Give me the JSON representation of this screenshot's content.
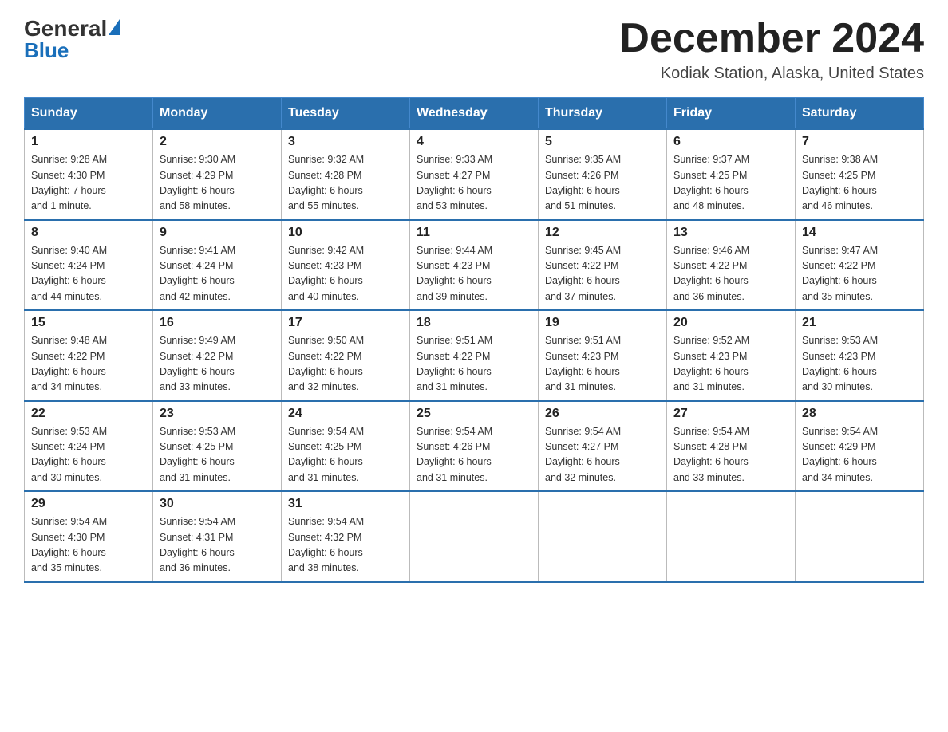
{
  "header": {
    "logo_general": "General",
    "logo_blue": "Blue",
    "month_title": "December 2024",
    "location": "Kodiak Station, Alaska, United States"
  },
  "days_of_week": [
    "Sunday",
    "Monday",
    "Tuesday",
    "Wednesday",
    "Thursday",
    "Friday",
    "Saturday"
  ],
  "weeks": [
    [
      {
        "day": "1",
        "sunrise": "Sunrise: 9:28 AM",
        "sunset": "Sunset: 4:30 PM",
        "daylight": "Daylight: 7 hours",
        "daylight2": "and 1 minute."
      },
      {
        "day": "2",
        "sunrise": "Sunrise: 9:30 AM",
        "sunset": "Sunset: 4:29 PM",
        "daylight": "Daylight: 6 hours",
        "daylight2": "and 58 minutes."
      },
      {
        "day": "3",
        "sunrise": "Sunrise: 9:32 AM",
        "sunset": "Sunset: 4:28 PM",
        "daylight": "Daylight: 6 hours",
        "daylight2": "and 55 minutes."
      },
      {
        "day": "4",
        "sunrise": "Sunrise: 9:33 AM",
        "sunset": "Sunset: 4:27 PM",
        "daylight": "Daylight: 6 hours",
        "daylight2": "and 53 minutes."
      },
      {
        "day": "5",
        "sunrise": "Sunrise: 9:35 AM",
        "sunset": "Sunset: 4:26 PM",
        "daylight": "Daylight: 6 hours",
        "daylight2": "and 51 minutes."
      },
      {
        "day": "6",
        "sunrise": "Sunrise: 9:37 AM",
        "sunset": "Sunset: 4:25 PM",
        "daylight": "Daylight: 6 hours",
        "daylight2": "and 48 minutes."
      },
      {
        "day": "7",
        "sunrise": "Sunrise: 9:38 AM",
        "sunset": "Sunset: 4:25 PM",
        "daylight": "Daylight: 6 hours",
        "daylight2": "and 46 minutes."
      }
    ],
    [
      {
        "day": "8",
        "sunrise": "Sunrise: 9:40 AM",
        "sunset": "Sunset: 4:24 PM",
        "daylight": "Daylight: 6 hours",
        "daylight2": "and 44 minutes."
      },
      {
        "day": "9",
        "sunrise": "Sunrise: 9:41 AM",
        "sunset": "Sunset: 4:24 PM",
        "daylight": "Daylight: 6 hours",
        "daylight2": "and 42 minutes."
      },
      {
        "day": "10",
        "sunrise": "Sunrise: 9:42 AM",
        "sunset": "Sunset: 4:23 PM",
        "daylight": "Daylight: 6 hours",
        "daylight2": "and 40 minutes."
      },
      {
        "day": "11",
        "sunrise": "Sunrise: 9:44 AM",
        "sunset": "Sunset: 4:23 PM",
        "daylight": "Daylight: 6 hours",
        "daylight2": "and 39 minutes."
      },
      {
        "day": "12",
        "sunrise": "Sunrise: 9:45 AM",
        "sunset": "Sunset: 4:22 PM",
        "daylight": "Daylight: 6 hours",
        "daylight2": "and 37 minutes."
      },
      {
        "day": "13",
        "sunrise": "Sunrise: 9:46 AM",
        "sunset": "Sunset: 4:22 PM",
        "daylight": "Daylight: 6 hours",
        "daylight2": "and 36 minutes."
      },
      {
        "day": "14",
        "sunrise": "Sunrise: 9:47 AM",
        "sunset": "Sunset: 4:22 PM",
        "daylight": "Daylight: 6 hours",
        "daylight2": "and 35 minutes."
      }
    ],
    [
      {
        "day": "15",
        "sunrise": "Sunrise: 9:48 AM",
        "sunset": "Sunset: 4:22 PM",
        "daylight": "Daylight: 6 hours",
        "daylight2": "and 34 minutes."
      },
      {
        "day": "16",
        "sunrise": "Sunrise: 9:49 AM",
        "sunset": "Sunset: 4:22 PM",
        "daylight": "Daylight: 6 hours",
        "daylight2": "and 33 minutes."
      },
      {
        "day": "17",
        "sunrise": "Sunrise: 9:50 AM",
        "sunset": "Sunset: 4:22 PM",
        "daylight": "Daylight: 6 hours",
        "daylight2": "and 32 minutes."
      },
      {
        "day": "18",
        "sunrise": "Sunrise: 9:51 AM",
        "sunset": "Sunset: 4:22 PM",
        "daylight": "Daylight: 6 hours",
        "daylight2": "and 31 minutes."
      },
      {
        "day": "19",
        "sunrise": "Sunrise: 9:51 AM",
        "sunset": "Sunset: 4:23 PM",
        "daylight": "Daylight: 6 hours",
        "daylight2": "and 31 minutes."
      },
      {
        "day": "20",
        "sunrise": "Sunrise: 9:52 AM",
        "sunset": "Sunset: 4:23 PM",
        "daylight": "Daylight: 6 hours",
        "daylight2": "and 31 minutes."
      },
      {
        "day": "21",
        "sunrise": "Sunrise: 9:53 AM",
        "sunset": "Sunset: 4:23 PM",
        "daylight": "Daylight: 6 hours",
        "daylight2": "and 30 minutes."
      }
    ],
    [
      {
        "day": "22",
        "sunrise": "Sunrise: 9:53 AM",
        "sunset": "Sunset: 4:24 PM",
        "daylight": "Daylight: 6 hours",
        "daylight2": "and 30 minutes."
      },
      {
        "day": "23",
        "sunrise": "Sunrise: 9:53 AM",
        "sunset": "Sunset: 4:25 PM",
        "daylight": "Daylight: 6 hours",
        "daylight2": "and 31 minutes."
      },
      {
        "day": "24",
        "sunrise": "Sunrise: 9:54 AM",
        "sunset": "Sunset: 4:25 PM",
        "daylight": "Daylight: 6 hours",
        "daylight2": "and 31 minutes."
      },
      {
        "day": "25",
        "sunrise": "Sunrise: 9:54 AM",
        "sunset": "Sunset: 4:26 PM",
        "daylight": "Daylight: 6 hours",
        "daylight2": "and 31 minutes."
      },
      {
        "day": "26",
        "sunrise": "Sunrise: 9:54 AM",
        "sunset": "Sunset: 4:27 PM",
        "daylight": "Daylight: 6 hours",
        "daylight2": "and 32 minutes."
      },
      {
        "day": "27",
        "sunrise": "Sunrise: 9:54 AM",
        "sunset": "Sunset: 4:28 PM",
        "daylight": "Daylight: 6 hours",
        "daylight2": "and 33 minutes."
      },
      {
        "day": "28",
        "sunrise": "Sunrise: 9:54 AM",
        "sunset": "Sunset: 4:29 PM",
        "daylight": "Daylight: 6 hours",
        "daylight2": "and 34 minutes."
      }
    ],
    [
      {
        "day": "29",
        "sunrise": "Sunrise: 9:54 AM",
        "sunset": "Sunset: 4:30 PM",
        "daylight": "Daylight: 6 hours",
        "daylight2": "and 35 minutes."
      },
      {
        "day": "30",
        "sunrise": "Sunrise: 9:54 AM",
        "sunset": "Sunset: 4:31 PM",
        "daylight": "Daylight: 6 hours",
        "daylight2": "and 36 minutes."
      },
      {
        "day": "31",
        "sunrise": "Sunrise: 9:54 AM",
        "sunset": "Sunset: 4:32 PM",
        "daylight": "Daylight: 6 hours",
        "daylight2": "and 38 minutes."
      },
      null,
      null,
      null,
      null
    ]
  ]
}
